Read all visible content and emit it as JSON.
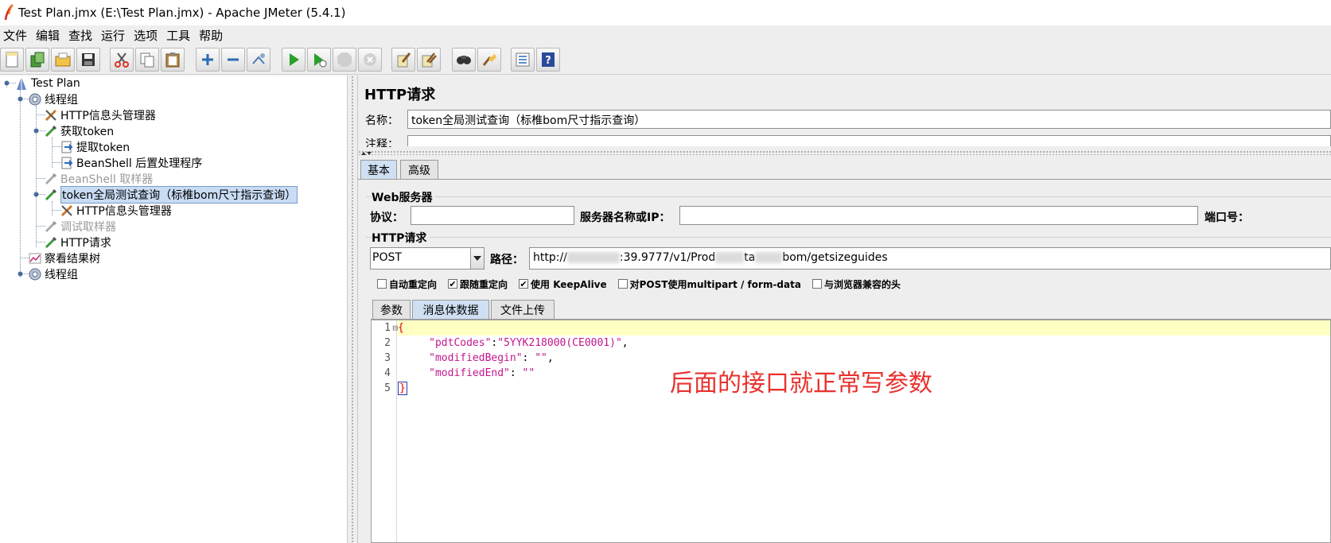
{
  "window": {
    "title": "Test Plan.jmx (E:\\Test Plan.jmx) - Apache JMeter (5.4.1)"
  },
  "menu": [
    "文件",
    "编辑",
    "查找",
    "运行",
    "选项",
    "工具",
    "帮助"
  ],
  "toolbar": [
    "new-icon",
    "templates-icon",
    "open-icon",
    "save-icon",
    "cut-icon",
    "copy-icon",
    "paste-icon",
    "expand-icon",
    "collapse-icon",
    "toggle-icon",
    "start-icon",
    "start-no-pause-icon",
    "stop-icon",
    "shutdown-icon",
    "clear-icon",
    "clear-all-icon",
    "search-icon",
    "reset-search-icon",
    "function-helper-icon",
    "help-icon"
  ],
  "tree": {
    "items": [
      {
        "label": "Test Plan"
      },
      {
        "label": "线程组"
      },
      {
        "label": "HTTP信息头管理器"
      },
      {
        "label": "获取token"
      },
      {
        "label": "提取token"
      },
      {
        "label": "BeanShell 后置处理程序"
      },
      {
        "label": "BeanShell 取样器"
      },
      {
        "label": "token全局测试查询（标椎bom尺寸指示查询）"
      },
      {
        "label": "HTTP信息头管理器"
      },
      {
        "label": "调试取样器"
      },
      {
        "label": "HTTP请求"
      },
      {
        "label": "察看结果树"
      },
      {
        "label": "线程组"
      }
    ]
  },
  "panel": {
    "title": "HTTP请求",
    "name_label": "名称：",
    "name_value": "token全局测试查询（标椎bom尺寸指示查询）",
    "comment_label": "注释：",
    "tabs": [
      "基本",
      "高级"
    ],
    "web_server": {
      "group_title": "Web服务器",
      "protocol_label": "协议：",
      "server_label": "服务器名称或IP：",
      "port_label": "端口号："
    },
    "http_request": {
      "group_title": "HTTP请求",
      "method": "POST",
      "path_label": "路径：",
      "path_prefix": "http://",
      "path_part2": ":39.9777/v1/Prod",
      "path_part3": "ta",
      "path_suffix": "bom/getsizeguides"
    },
    "checkboxes": [
      {
        "label": "自动重定向",
        "checked": false
      },
      {
        "label": "跟随重定向",
        "checked": true
      },
      {
        "label": "使用 KeepAlive",
        "checked": true
      },
      {
        "label": "对POST使用multipart / form-data",
        "checked": false
      },
      {
        "label": "与浏览器兼容的头",
        "checked": false
      }
    ],
    "sub_tabs": [
      "参数",
      "消息体数据",
      "文件上传"
    ],
    "body": {
      "line_numbers": [
        "1",
        "2",
        "3",
        "4",
        "5"
      ],
      "fold_marker": "⊟",
      "open_brace": "{",
      "key1": "\"pdtCodes\"",
      "val1": "\"5YYK218000(CE0001)\"",
      "key2": "\"modifiedBegin\"",
      "val2": "\"\"",
      "key3": "\"modifiedEnd\"",
      "val3": "\"\"",
      "close_brace": "}"
    },
    "annotation": "后面的接口就正常写参数"
  }
}
